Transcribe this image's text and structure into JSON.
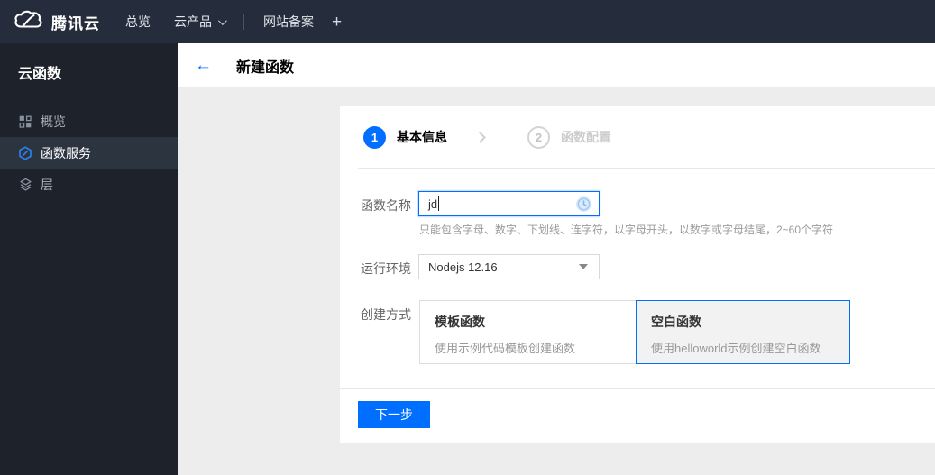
{
  "topnav": {
    "brand": "腾讯云",
    "items": [
      {
        "label": "总览"
      },
      {
        "label": "云产品",
        "has_caret": true
      },
      {
        "label": "网站备案"
      }
    ],
    "add_label": "+"
  },
  "sidebar": {
    "title": "云函数",
    "items": [
      {
        "label": "概览",
        "icon": "grid-overview-icon",
        "active": false
      },
      {
        "label": "函数服务",
        "icon": "hexagon-function-icon",
        "active": true
      },
      {
        "label": "层",
        "icon": "layers-icon",
        "active": false
      }
    ]
  },
  "header": {
    "back_icon": "←",
    "title": "新建函数"
  },
  "wizard": {
    "steps": [
      {
        "number": "1",
        "label": "基本信息",
        "state": "current"
      },
      {
        "number": "2",
        "label": "函数配置",
        "state": "todo"
      }
    ]
  },
  "form": {
    "name": {
      "label": "函数名称",
      "value": "jd",
      "status_icon": "pending-clock-icon",
      "hint": "只能包含字母、数字、下划线、连字符，以字母开头，以数字或字母结尾，2~60个字符"
    },
    "runtime": {
      "label": "运行环境",
      "value": "Nodejs 12.16"
    },
    "method": {
      "label": "创建方式",
      "options": [
        {
          "title": "模板函数",
          "desc": "使用示例代码模板创建函数",
          "selected": false
        },
        {
          "title": "空白函数",
          "desc": "使用helloworld示例创建空白函数",
          "selected": true
        }
      ]
    },
    "next_button": "下一步"
  },
  "colors": {
    "accent_blue": "#006eff",
    "icon_blue": "#2d7ee9",
    "topnav_bg": "#252d3c",
    "sidebar_bg": "#1e222a",
    "sidebar_active_bg": "#2c3440",
    "content_bg": "#ededee",
    "selected_card_bg": "#f2f2f3",
    "divider": "#e8e8e8"
  }
}
